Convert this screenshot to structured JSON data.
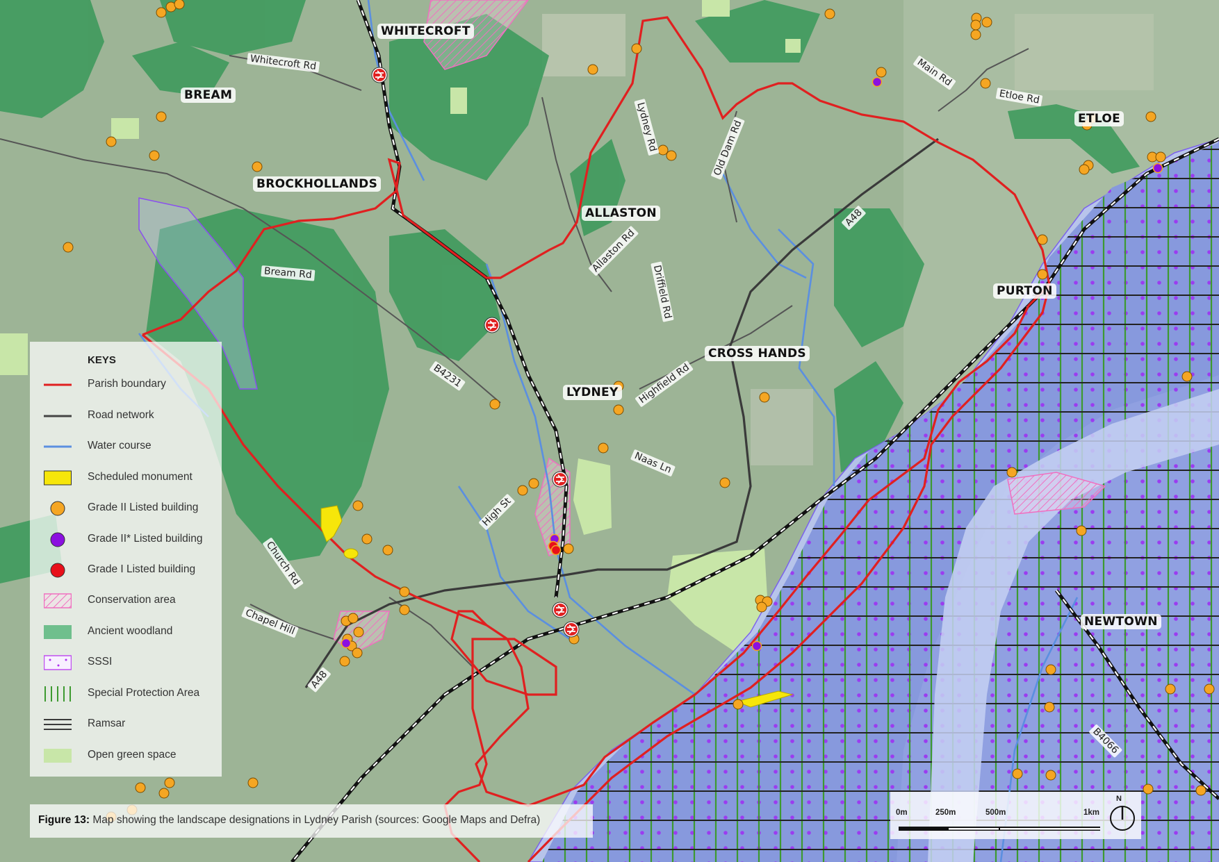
{
  "places": [
    {
      "id": "whitecroft",
      "label": "WHITECROFT"
    },
    {
      "id": "bream",
      "label": "BREAM"
    },
    {
      "id": "brockhollands",
      "label": "BROCKHOLLANDS"
    },
    {
      "id": "allaston",
      "label": "ALLASTON"
    },
    {
      "id": "lydney",
      "label": "LYDNEY"
    },
    {
      "id": "cross-hands",
      "label": "CROSS HANDS"
    },
    {
      "id": "purton",
      "label": "PURTON"
    },
    {
      "id": "etloe",
      "label": "ETLOE"
    },
    {
      "id": "newtown",
      "label": "NEWTOWN"
    }
  ],
  "roads": [
    {
      "id": "whitecroft-rd",
      "label": "Whitecroft Rd"
    },
    {
      "id": "bream-rd",
      "label": "Bream Rd"
    },
    {
      "id": "b4231",
      "label": "B4231"
    },
    {
      "id": "lydney-rd",
      "label": "Lydney Rd"
    },
    {
      "id": "old-dam-rd",
      "label": "Old Dam Rd"
    },
    {
      "id": "main-rd",
      "label": "Main Rd"
    },
    {
      "id": "etloe-rd",
      "label": "Etloe Rd"
    },
    {
      "id": "a48-north",
      "label": "A48"
    },
    {
      "id": "allaston-rd",
      "label": "Allaston Rd"
    },
    {
      "id": "driffield-rd",
      "label": "Driffield Rd"
    },
    {
      "id": "highfield-rd",
      "label": "Highfield Rd"
    },
    {
      "id": "naas-ln",
      "label": "Naas Ln"
    },
    {
      "id": "high-st",
      "label": "High St"
    },
    {
      "id": "church-rd",
      "label": "Church Rd"
    },
    {
      "id": "chapel-hill",
      "label": "Chapel Hill"
    },
    {
      "id": "a48-south",
      "label": "A48"
    },
    {
      "id": "b4066",
      "label": "B4066"
    }
  ],
  "legend": {
    "title": "KEYS",
    "items": [
      {
        "key": "parish",
        "label": "Parish boundary"
      },
      {
        "key": "road",
        "label": "Road network"
      },
      {
        "key": "water",
        "label": "Water course"
      },
      {
        "key": "monument",
        "label": "Scheduled monument"
      },
      {
        "key": "grade2",
        "label": "Grade II Listed building"
      },
      {
        "key": "grade2star",
        "label": "Grade II* Listed building"
      },
      {
        "key": "grade1",
        "label": "Grade I Listed building"
      },
      {
        "key": "conservation",
        "label": "Conservation area"
      },
      {
        "key": "woodland",
        "label": "Ancient woodland"
      },
      {
        "key": "sssi",
        "label": "SSSI"
      },
      {
        "key": "spa",
        "label": "Special Protection Area"
      },
      {
        "key": "ramsar",
        "label": "Ramsar"
      },
      {
        "key": "green",
        "label": "Open green space"
      }
    ]
  },
  "caption": {
    "prefix": "Figure 13:",
    "text": " Map showing the landscape designations in Lydney Parish (sources: Google Maps and Defra)"
  },
  "scale": {
    "ticks": [
      "0m",
      "250m",
      "500m",
      "1km"
    ],
    "north": "N"
  },
  "colors": {
    "parish": "#e02020",
    "road": "#444444",
    "water": "#5b8fe0",
    "monument": "#f6e60a",
    "grade2": "#f5a623",
    "grade2star": "#8b10e0",
    "grade1": "#e8101a",
    "conservation": "#f070c0",
    "woodland": "#3c9a5a",
    "sssi": "#8a6ef0",
    "spa": "#3d9a30",
    "ramsar": "#222222",
    "green": "#c8e6a8"
  }
}
